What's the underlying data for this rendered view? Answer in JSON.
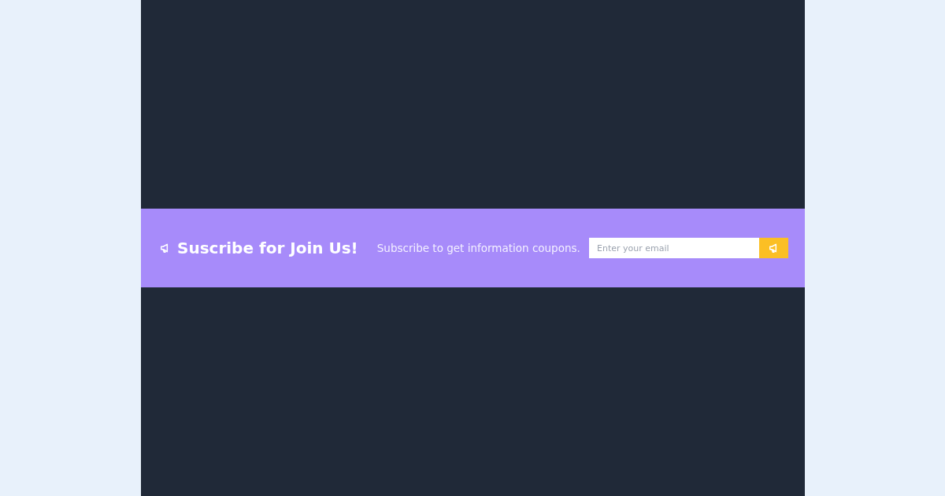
{
  "banner": {
    "heading": "Suscribe for Join Us!",
    "subtext": "Subscribe to get information coupons."
  },
  "subscribe_form": {
    "email": {
      "placeholder": "Enter your email"
    }
  }
}
